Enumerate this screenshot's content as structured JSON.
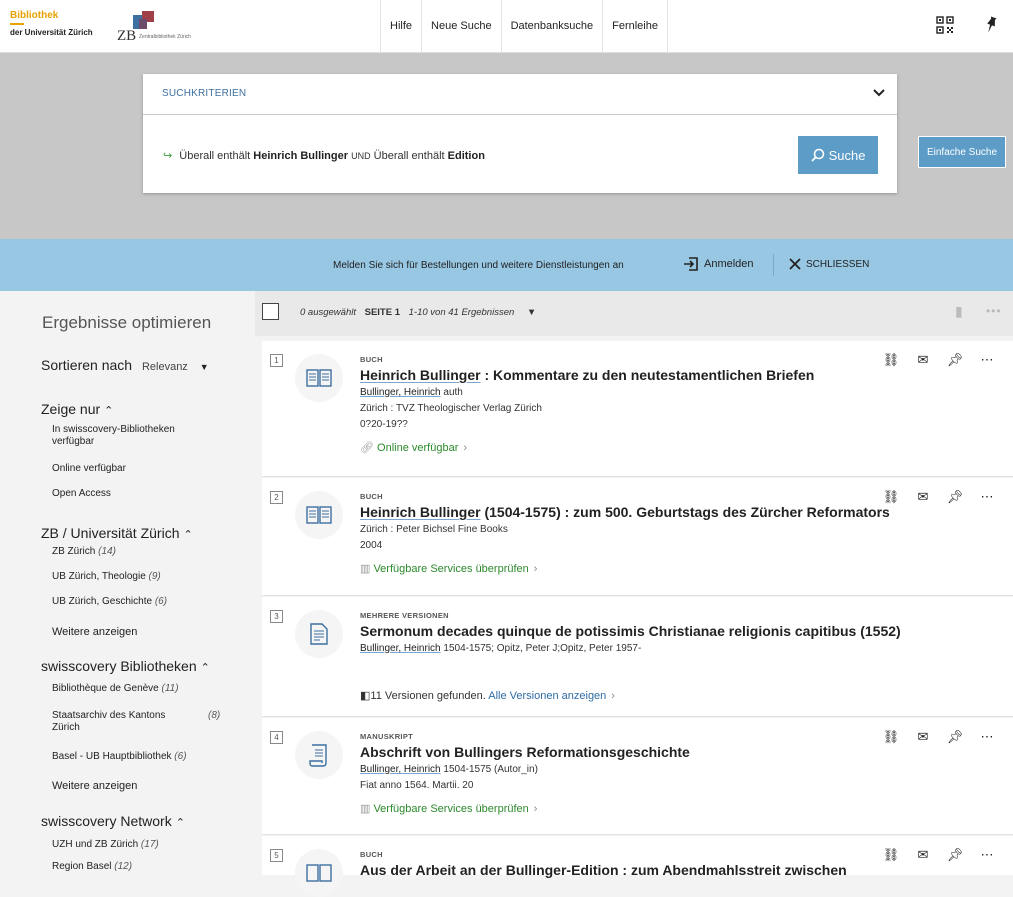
{
  "logo": {
    "uzh_line1": "Bibliothek",
    "uzh_line2": "der Universität Zürich",
    "zb_mark": "ZB",
    "zb_small": "Zentralbibliothek Zürich"
  },
  "nav": [
    "Hilfe",
    "Neue Suche",
    "Datenbanksuche",
    "Fernleihe"
  ],
  "top_icons": [
    "qr-code-icon",
    "pin-icon"
  ],
  "search": {
    "tab_label": "SUCHKRITERIEN",
    "criteria": {
      "part1_field": "Überall enthält",
      "part1_value": "Heinrich Bullinger",
      "operator": "UND",
      "part2_field": "Überall enthält",
      "part2_value": "Edition"
    },
    "search_button": "Suche",
    "simple_search_button": "Einfache Suche"
  },
  "banner": {
    "text": "Melden Sie sich für Bestellungen und weitere Dienstleistungen an",
    "login": "Anmelden",
    "close": "SCHLIESSEN"
  },
  "sidebar": {
    "title": "Ergebnisse optimieren",
    "sort_label": "Sortieren nach",
    "sort_value": "Relevanz",
    "facets": [
      {
        "heading": "Zeige nur",
        "items": [
          {
            "label": "In swisscovery-Bibliotheken verfügbar",
            "count": ""
          },
          {
            "label": "Online verfügbar",
            "count": ""
          },
          {
            "label": "Open Access",
            "count": ""
          }
        ]
      },
      {
        "heading": "ZB / Universität Zürich",
        "items": [
          {
            "label": "ZB Zürich",
            "count": "(14)"
          },
          {
            "label": "UB Zürich, Theologie",
            "count": "(9)"
          },
          {
            "label": "UB Zürich, Geschichte",
            "count": "(6)"
          }
        ],
        "more": "Weitere anzeigen"
      },
      {
        "heading": "swisscovery Bibliotheken",
        "items": [
          {
            "label": "Bibliothèque de Genève",
            "count": "(11)"
          },
          {
            "label": "Staatsarchiv des Kantons Zürich",
            "count": "(8)"
          },
          {
            "label": "Basel - UB Hauptbibliothek",
            "count": "(6)"
          }
        ],
        "more": "Weitere anzeigen"
      },
      {
        "heading": "swisscovery Network",
        "items": [
          {
            "label": "UZH und ZB Zürich",
            "count": "(17)"
          },
          {
            "label": "Region Basel",
            "count": "(12)"
          }
        ]
      }
    ]
  },
  "results_header": {
    "selected": "0 ausgewählt",
    "page": "SEITE 1",
    "range": "1-10 von 41 Ergebnissen"
  },
  "results": [
    {
      "num": "1",
      "type": "BUCH",
      "title_link": "Heinrich Bullinger",
      "title_rest": " : Kommentare zu den neutestamentlichen Briefen",
      "author": "Bullinger, Heinrich",
      "author_role": " auth",
      "line2": "Zürich : TVZ Theologischer Verlag Zürich",
      "line3": "0?20-19??",
      "availability": "Online verfügbar"
    },
    {
      "num": "2",
      "type": "BUCH",
      "title_link": "Heinrich Bullinger",
      "title_rest": " (1504-1575) : zum 500. Geburtstags des Zürcher Reformators",
      "line1": "Zürich : Peter Bichsel Fine Books",
      "line2": "2004",
      "availability": "Verfügbare Services überprüfen"
    },
    {
      "num": "3",
      "type": "MEHRERE VERSIONEN",
      "title": "Sermonum decades quinque de potissimis Christianae religionis capitibus (1552)",
      "author": "Bullinger, Heinrich",
      "author_rest": " 1504-1575; Opitz, Peter J;Opitz, Peter 1957-",
      "versions_text": "11 Versionen gefunden.",
      "versions_link": "Alle Versionen anzeigen"
    },
    {
      "num": "4",
      "type": "MANUSKRIPT",
      "title": "Abschrift von Bullingers Reformationsgeschichte",
      "author": "Bullinger, Heinrich",
      "author_rest": " 1504-1575 (Autor_in)",
      "line2": "Fiat anno 1564. Martii. 20",
      "availability": "Verfügbare Services überprüfen"
    },
    {
      "num": "5",
      "type": "BUCH",
      "title": "Aus der Arbeit an der Bullinger-Edition : zum Abendmahlsstreit zwischen"
    }
  ]
}
